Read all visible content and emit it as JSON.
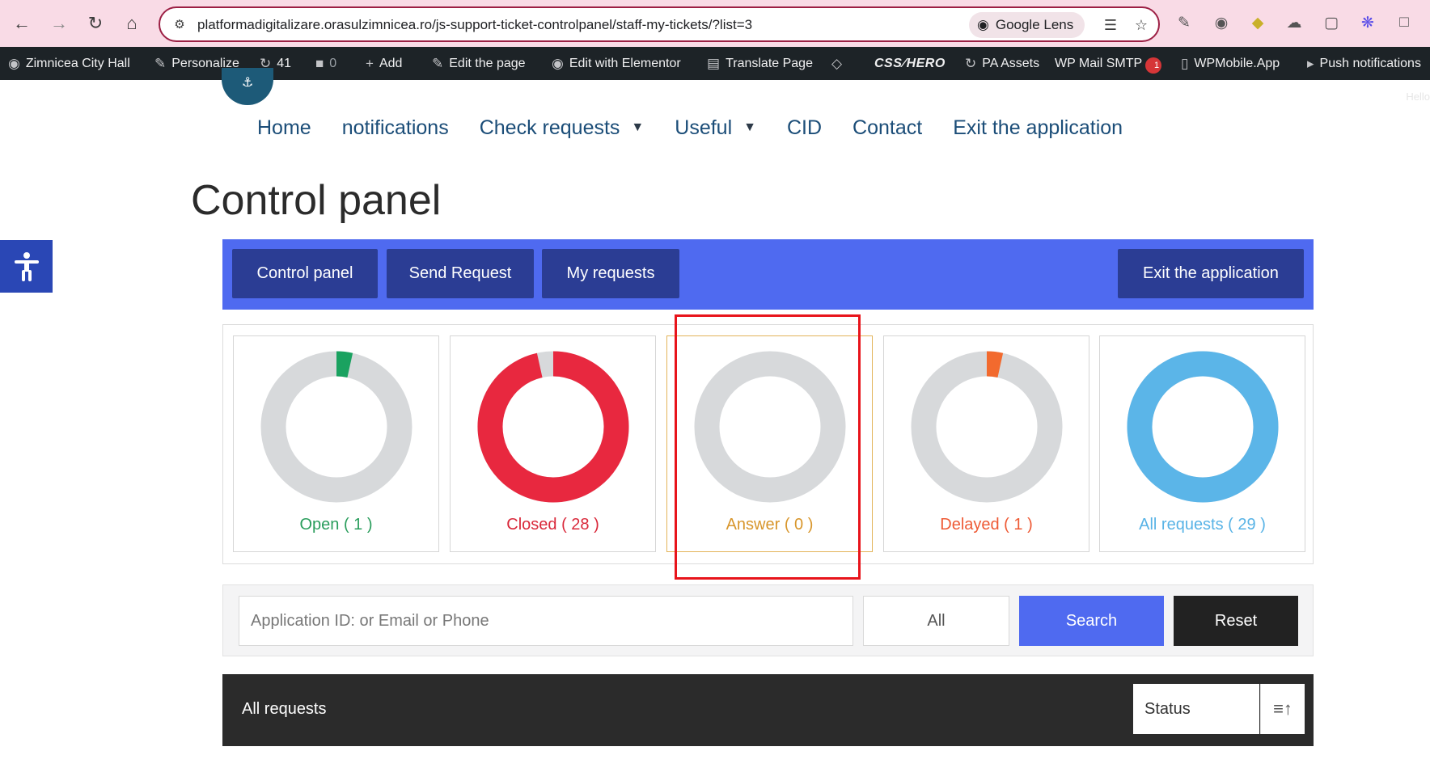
{
  "browser": {
    "url": "platformadigitalizare.orasulzimnicea.ro/js-support-ticket-controlpanel/staff-my-tickets/?list=3",
    "lens_label": "Google Lens"
  },
  "adminbar": {
    "site_name": "Zimnicea City Hall",
    "personalize": "Personalize",
    "updates_count": "41",
    "comments_count": "0",
    "add": "Add",
    "edit_page": "Edit the page",
    "edit_elementor": "Edit with Elementor",
    "translate": "Translate Page",
    "css_hero": "CSS",
    "css_hero_b": "HERO",
    "pa_assets": "PA Assets",
    "wp_mail": "WP Mail SMTP",
    "wp_mail_badge": "1",
    "wpmobile": "WPMobile.App",
    "push": "Push notifications",
    "hello": "Hello"
  },
  "nav": {
    "home": "Home",
    "notifications": "notifications",
    "check_requests": "Check requests",
    "useful": "Useful",
    "cid": "CID",
    "contact": "Contact",
    "exit": "Exit the application",
    "caret": "▼"
  },
  "page": {
    "title": "Control panel"
  },
  "toolbar": {
    "control_panel": "Control panel",
    "send_request": "Send Request",
    "my_requests": "My requests",
    "exit": "Exit the application"
  },
  "stats": [
    {
      "label": "Open ( 1 )",
      "fraction": 0.0345,
      "color": "#1aa260",
      "text_color": "#2a9d5c"
    },
    {
      "label": "Closed ( 28 )",
      "fraction": 0.9655,
      "color": "#e8283f",
      "text_color": "#d9283a"
    },
    {
      "label": "Answer ( 0 )",
      "fraction": 0,
      "color": "#e8a33b",
      "text_color": "#d8962c"
    },
    {
      "label": "Delayed ( 1 )",
      "fraction": 0.0345,
      "color": "#f26a2e",
      "text_color": "#ee5a35"
    },
    {
      "label": "All requests ( 29 )",
      "fraction": 1,
      "color": "#5bb5e8",
      "text_color": "#58b3e6"
    }
  ],
  "search": {
    "placeholder": "Application ID: or Email or Phone",
    "status_value": "All",
    "search_label": "Search",
    "reset_label": "Reset"
  },
  "list": {
    "title": "All requests",
    "sort_value": "Status"
  },
  "colors": {
    "ring_track": "#d7d9db",
    "toolbar_bg": "#4f6af0",
    "toolbar_btn": "#2b3d94",
    "highlight_frame": "#e8141b"
  }
}
